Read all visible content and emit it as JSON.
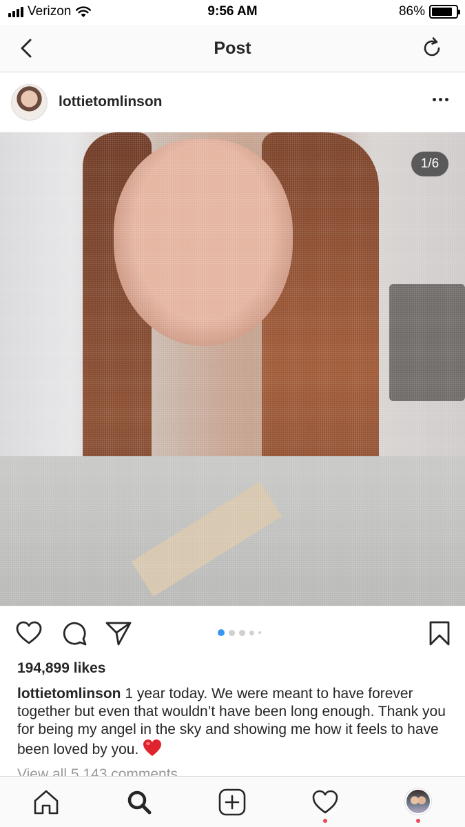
{
  "status_bar": {
    "carrier": "Verizon",
    "time": "9:56 AM",
    "battery_percent": "86%",
    "battery_level": 0.86,
    "icons": [
      "signal-icon",
      "wifi-icon",
      "battery-icon"
    ]
  },
  "nav": {
    "title": "Post",
    "icons": [
      "back-chevron-icon",
      "refresh-icon"
    ]
  },
  "post": {
    "username": "lottietomlinson",
    "photo_counter": "1/6",
    "carousel_current_index": 1,
    "carousel_total": 6,
    "likes": "194,899 likes",
    "caption_user": "lottietomlinson",
    "caption_text": " 1 year today. We were meant to have forever together but even that wouldn’t have been long enough. Thank you for being my angel in the sky and showing me how it feels to have been loved by you. ",
    "caption_emoji": "red-heart-emoji",
    "view_comments": "View all 5,143 comments",
    "action_icons": [
      "heart-icon",
      "comment-icon",
      "share-icon",
      "bookmark-icon"
    ]
  },
  "tab_bar": {
    "tabs": [
      "home-icon",
      "search-icon",
      "new-post-icon",
      "activity-heart-icon",
      "profile-avatar"
    ],
    "active_tab": "search-icon"
  },
  "colors": {
    "text": "#262626",
    "muted": "#999999",
    "accent_blue": "#3897f0",
    "notification_red": "#ed4956",
    "border": "#dbdbdb"
  }
}
